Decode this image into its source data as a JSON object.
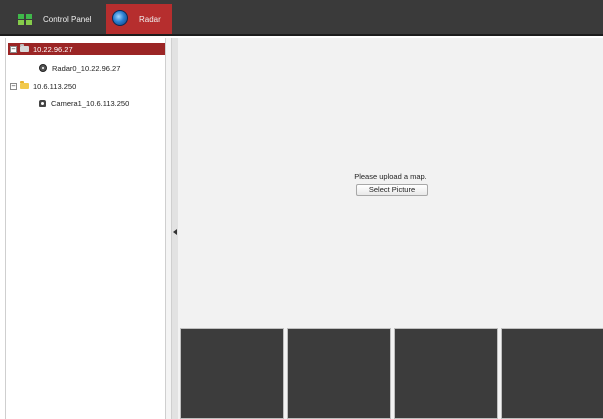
{
  "tabs": [
    {
      "label": "Control Panel",
      "icon": "grid-icon",
      "active": false
    },
    {
      "label": "Radar",
      "icon": "radar-icon",
      "active": true
    }
  ],
  "tree": {
    "items": [
      {
        "label": "10.22.96.27",
        "type": "group",
        "expanded": true,
        "selected": true,
        "toggle": "−"
      },
      {
        "label": "Radar0_10.22.96.27",
        "type": "radar",
        "selected": false
      },
      {
        "label": "10.6.113.250",
        "type": "group",
        "expanded": true,
        "selected": false,
        "toggle": "−"
      },
      {
        "label": "Camera1_10.6.113.250",
        "type": "camera",
        "selected": false
      }
    ]
  },
  "main": {
    "message": "Please upload a map.",
    "select_button": "Select Picture",
    "thumbnail_count": 4
  },
  "colors": {
    "topbar": "#3a3a3a",
    "active_tab": "#b62e2e",
    "selected_row": "#9b2525",
    "thumbnail": "#3c3c3c"
  }
}
